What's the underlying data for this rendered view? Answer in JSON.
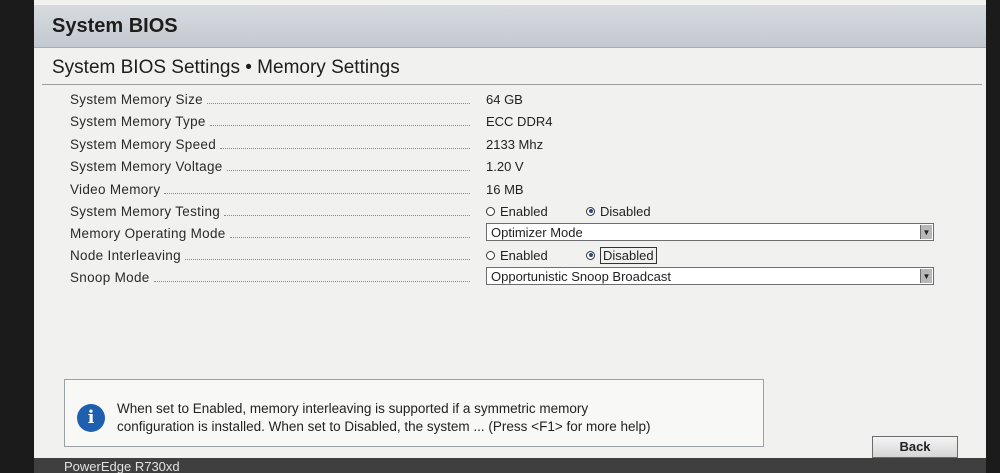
{
  "window": {
    "title": "System BIOS",
    "subtitle": "System BIOS Settings • Memory Settings"
  },
  "settings": [
    {
      "label": "System Memory Size",
      "value": "64 GB"
    },
    {
      "label": "System Memory Type",
      "value": "ECC DDR4"
    },
    {
      "label": "System Memory Speed",
      "value": "2133 Mhz"
    },
    {
      "label": "System Memory Voltage",
      "value": "1.20 V"
    },
    {
      "label": "Video Memory",
      "value": "16 MB"
    },
    {
      "label": "System Memory Testing",
      "options": [
        "Enabled",
        "Disabled"
      ],
      "selected": "Disabled"
    },
    {
      "label": "Memory Operating Mode",
      "value": "Optimizer Mode"
    },
    {
      "label": "Node Interleaving",
      "options": [
        "Enabled",
        "Disabled"
      ],
      "selected": "Disabled"
    },
    {
      "label": "Snoop Mode",
      "value": "Opportunistic Snoop Broadcast"
    }
  ],
  "help": {
    "line1": "When set to Enabled, memory interleaving is supported if a symmetric memory",
    "line2": "configuration is installed. When set to Disabled, the system ... (Press <F1> for more help)"
  },
  "buttons": {
    "back": "Back"
  },
  "footer": {
    "model": "PowerEdge R730xd"
  },
  "colors": {
    "title_bar": "#c9ced4",
    "info_icon": "#1f5fb0",
    "screen_bg": "#f1f1ef"
  }
}
